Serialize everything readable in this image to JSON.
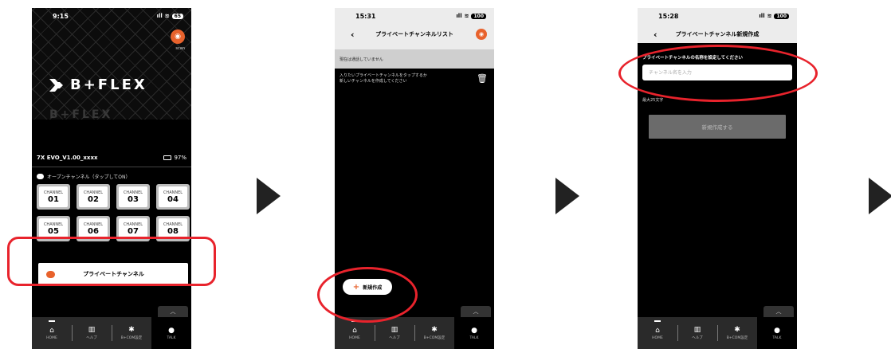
{
  "screen1": {
    "time": "9:15",
    "signal": "ıll",
    "wifi": "≋",
    "battery_level": "65",
    "scan_label": "scan",
    "logo": "B+FLEX",
    "device_name": "7X EVO_V1.00_xxxx",
    "battery_percent": "97%",
    "open_channel_label": "オープンチャンネル（タップしてON）",
    "channel_caption": "CHANNEL",
    "channels": [
      "01",
      "02",
      "03",
      "04",
      "05",
      "06",
      "07",
      "08"
    ],
    "private_channel_label": "プライベートチャンネル",
    "collapse_icon": "︿"
  },
  "screen2": {
    "time": "15:31",
    "signal": "ıll",
    "wifi": "≋",
    "battery_level": "100",
    "back_icon": "‹",
    "title": "プライベートチャンネルリスト",
    "status_text": "現在は通話していません",
    "instruction_line1": "入りたいプライベートチャンネルをタップするか",
    "instruction_line2": "新しいチャンネルを作成してください",
    "new_button_plus": "+",
    "new_button_label": "新規作成",
    "collapse_icon": "︿"
  },
  "screen3": {
    "time": "15:28",
    "signal": "ıll",
    "wifi": "≋",
    "battery_level": "100",
    "back_icon": "‹",
    "title": "プライベートチャンネル新規作成",
    "field_label": "プライベートチャンネルの名称を設定してください",
    "input_placeholder": "チャンネル名を入力",
    "input_value": "",
    "max_length_hint": "最大25文字",
    "create_button_label": "新規作成する",
    "collapse_icon": "︿"
  },
  "tabbar": {
    "home": "HOME",
    "help": "ヘルプ",
    "settings": "B+COM設定",
    "talk": "TALK"
  },
  "colors": {
    "accent": "#e8622c",
    "highlight": "#e8232c"
  }
}
